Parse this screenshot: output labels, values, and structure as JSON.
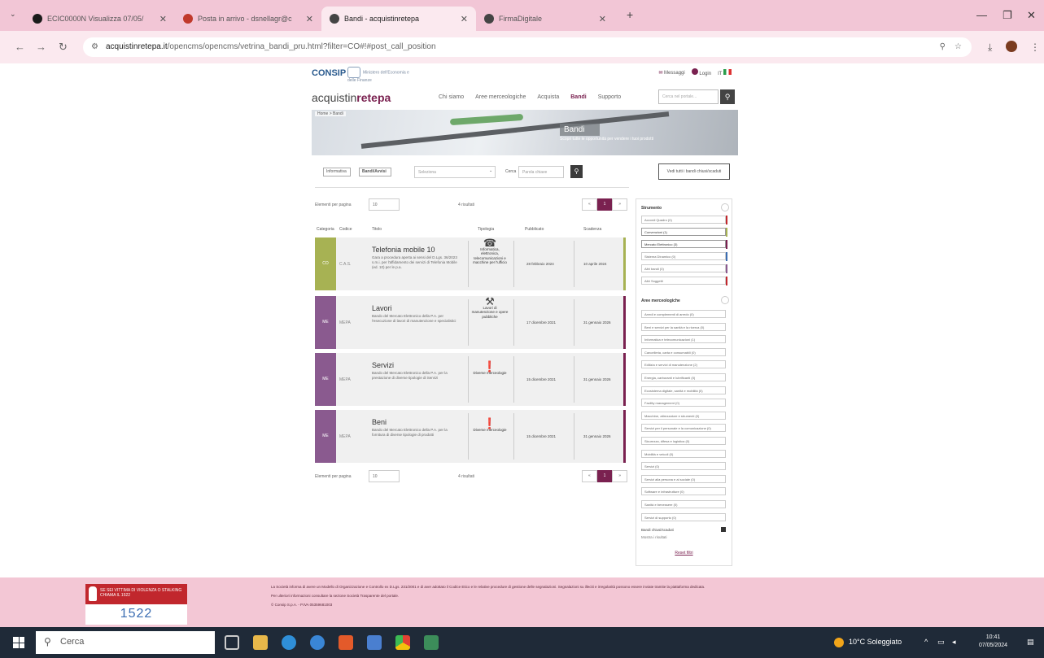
{
  "browser": {
    "tabs": [
      {
        "label": "ECIC0000N Visualizza 07/05/",
        "favicon_color": "#1a1a1a",
        "active": false
      },
      {
        "label": "Posta in arrivo - dsnellagr@c",
        "favicon_color": "#c0392b",
        "active": false
      },
      {
        "label": "Bandi - acquistinretepa",
        "favicon_color": "#444444",
        "active": true
      },
      {
        "label": "FirmaDigitale",
        "favicon_color": "#444444",
        "active": false
      }
    ],
    "new_tab": "+",
    "url_domain": "acquistinretepa.it",
    "url_path": "/opencms/opencms/vetrina_bandi_pru.html?filter=CO#!#post_call_position"
  },
  "site": {
    "logo": "CONSIP",
    "mef_text": "Ministero dell'Economia e delle Finanze",
    "top_links": [
      "Messaggi",
      "Login",
      "IT"
    ],
    "brand_prefix": "acquistin",
    "brand_suffix": "retepa",
    "nav": [
      "Chi siamo",
      "Aree merceologiche",
      "Acquista",
      "Bandi",
      "Supporto"
    ],
    "nav_active": "Bandi",
    "search_placeholder": "Cerca nel portale...",
    "hero": {
      "breadcrumb": "Home > Bandi",
      "title": "Bandi",
      "subtitle": "Scopri tutte le opportunità per vendere i tuoi prodotti"
    },
    "filters": {
      "pill1": "Informativa",
      "pill2": "Bandi/Avvisi",
      "select_placeholder": "Seleziona",
      "search_label": "Cerca",
      "search_placeholder": "Parola chiave",
      "outline_button": "Vedi tutti i bandi chiusi/scaduti"
    },
    "pagination": {
      "per_page_label": "Elementi per pagina",
      "per_page_value": "10",
      "results": "4 risultati",
      "pages": [
        "«",
        "1",
        "»"
      ],
      "current": "1"
    },
    "table_headers": [
      "Categoria",
      "Codice",
      "Titolo",
      "Tipologia",
      "Pubblicato",
      "Scadenza"
    ],
    "cards": [
      {
        "strip_label": "CO",
        "strip_color": "#a7b253",
        "bar_color": "#a7b253",
        "code": "C.A.S.",
        "title": "Telefonia mobile 10",
        "desc": "Gara a procedura aperta ai sensi del D.Lgs. 36/2023 s.m.i. per l'affidamento dei servizi di Telefonia Mobile (ed. 10) per le p.a.",
        "icon": "telephone-icon",
        "icon_glyph": "☎",
        "type": "Informatica, elettronica, telecomunicazioni e macchine per l'ufficio",
        "published": "28 febbraio 2024",
        "deadline": "10 aprile 2024"
      },
      {
        "strip_label": "ME",
        "strip_color": "#8a5a8f",
        "bar_color": "#7a2150",
        "code": "MEPA",
        "title": "Lavori",
        "desc": "Bando del Mercato Elettronico della P.A. per l'esecuzione di lavori di manutenzione e specialistici",
        "icon": "tools-icon",
        "icon_glyph": "⚒",
        "type": "Lavori di manutenzione e opere pubbliche",
        "published": "17 dicembre 2021",
        "deadline": "31 gennaio 2026"
      },
      {
        "strip_label": "ME",
        "strip_color": "#8a5a8f",
        "bar_color": "#7a2150",
        "code": "MEPA",
        "title": "Servizi",
        "desc": "Bando del Mercato Elettronico della P.A. per la prestazione di diverse tipologie di Servizi",
        "icon": "info-icon",
        "icon_glyph": "❗",
        "type": "Diverse merceologie",
        "published": "15 dicembre 2021",
        "deadline": "31 gennaio 2026"
      },
      {
        "strip_label": "ME",
        "strip_color": "#8a5a8f",
        "bar_color": "#7a2150",
        "code": "MEPA",
        "title": "Beni",
        "desc": "Bando del Mercato Elettronico della P.A. per la fornitura di diverse tipologie di prodotti",
        "icon": "info-icon",
        "icon_glyph": "❗",
        "type": "Diverse merceologie",
        "published": "15 dicembre 2021",
        "deadline": "31 gennaio 2026"
      }
    ],
    "sidebar": {
      "strumento_title": "Strumento",
      "strumenti": [
        "Accordi Quadro (0)",
        "Convenzioni (1)",
        "Mercato Elettronico (3)",
        "Sistema Dinamico (0)",
        "Altri bandi (0)",
        "Altri Soggetti"
      ],
      "strumenti_selected": [
        false,
        true,
        true,
        false,
        false,
        false
      ],
      "strumenti_bar_colors": [
        "#c1272d",
        "#a7b253",
        "#7a2150",
        "#3b6db2",
        "#8a5a8f",
        "#c1272d"
      ],
      "aree_title": "Aree merceologiche",
      "aree": [
        "Arredi e complementi di arredo (0)",
        "Beni e servizi per la sanità e la ricerca (0)",
        "Informatica e telecomunicazioni (1)",
        "Cancelleria, carta e consumabili (0)",
        "Edilizia e servizi di manutenzione (2)",
        "Energia, carburanti e lubrificanti (0)",
        "Ecosistema digitale, sanità e mobilità (0)",
        "Facility management (0)",
        "Macchine, attrezzature e strumenti (0)",
        "Servizi per il personale e la comunicazione (0)",
        "Sicurezza, difesa e logistica (0)",
        "Mobilità e veicoli (0)",
        "Servizi (0)",
        "Servizi alla persona e al sociale (0)",
        "Software e infrastrutture (0)",
        "Sanità e benessere (0)",
        "Servizi di supporto (0)"
      ],
      "chiusi_label": "Bandi chiusi/scaduti",
      "chiusi_sub": "Mostra i risultati",
      "reset": "Reset filtri"
    },
    "pagination_bottom": {
      "per_page_label": "Elementi per pagina",
      "per_page_value": "10",
      "results": "4 risultati"
    }
  },
  "footer": {
    "badge_text": "SE SEI VITTIMA DI VIOLENZA O STALKING CHIAMA IL 1522",
    "badge_number": "1522",
    "text_line1": "La Società informa di avere un Modello di Organizzazione e Controllo ex D.Lgs. 231/2001 e di aver adottato il Codice Etico e le relative procedure di gestione delle segnalazioni. Segnalazioni su illeciti e irregolarità possono essere inviate tramite la piattaforma dedicata.",
    "text_line2": "Per ulteriori informazioni consultare la sezione Società Trasparente del portale.",
    "text_line3": "© Consip S.p.A. - P.IVA 05359681003"
  },
  "taskbar": {
    "search_placeholder": "Cerca",
    "weather": "10°C Soleggiato",
    "time": "10:41",
    "date": "07/05/2024"
  }
}
